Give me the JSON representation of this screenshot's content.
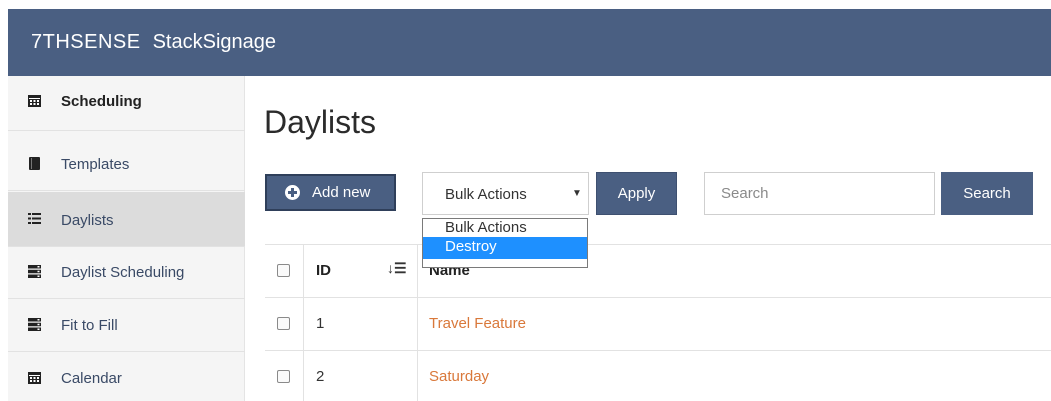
{
  "header": {
    "logo": "7THSENSE",
    "product": "StackSignage"
  },
  "sidebar": {
    "items": [
      {
        "label": "Scheduling",
        "icon": "calendar-icon"
      },
      {
        "label": "Templates",
        "icon": "book-icon"
      },
      {
        "label": "Daylists",
        "icon": "list-icon"
      },
      {
        "label": "Daylist Scheduling",
        "icon": "server-icon"
      },
      {
        "label": "Fit to Fill",
        "icon": "server-icon"
      },
      {
        "label": "Calendar",
        "icon": "calendar-icon"
      }
    ],
    "active": "Daylists"
  },
  "main": {
    "title": "Daylists",
    "add_new_label": "Add new",
    "bulk_select": {
      "value": "Bulk Actions",
      "options": [
        "Bulk Actions",
        "Destroy"
      ],
      "highlighted": "Destroy"
    },
    "apply_label": "Apply",
    "search_placeholder": "Search",
    "search_button_label": "Search"
  },
  "table": {
    "columns": [
      "ID",
      "Name"
    ],
    "rows": [
      {
        "id": "1",
        "name": "Travel Feature"
      },
      {
        "id": "2",
        "name": "Saturday"
      }
    ]
  },
  "colors": {
    "primary": "#4a5f82",
    "link": "#d9783a",
    "highlight": "#1e90ff"
  }
}
